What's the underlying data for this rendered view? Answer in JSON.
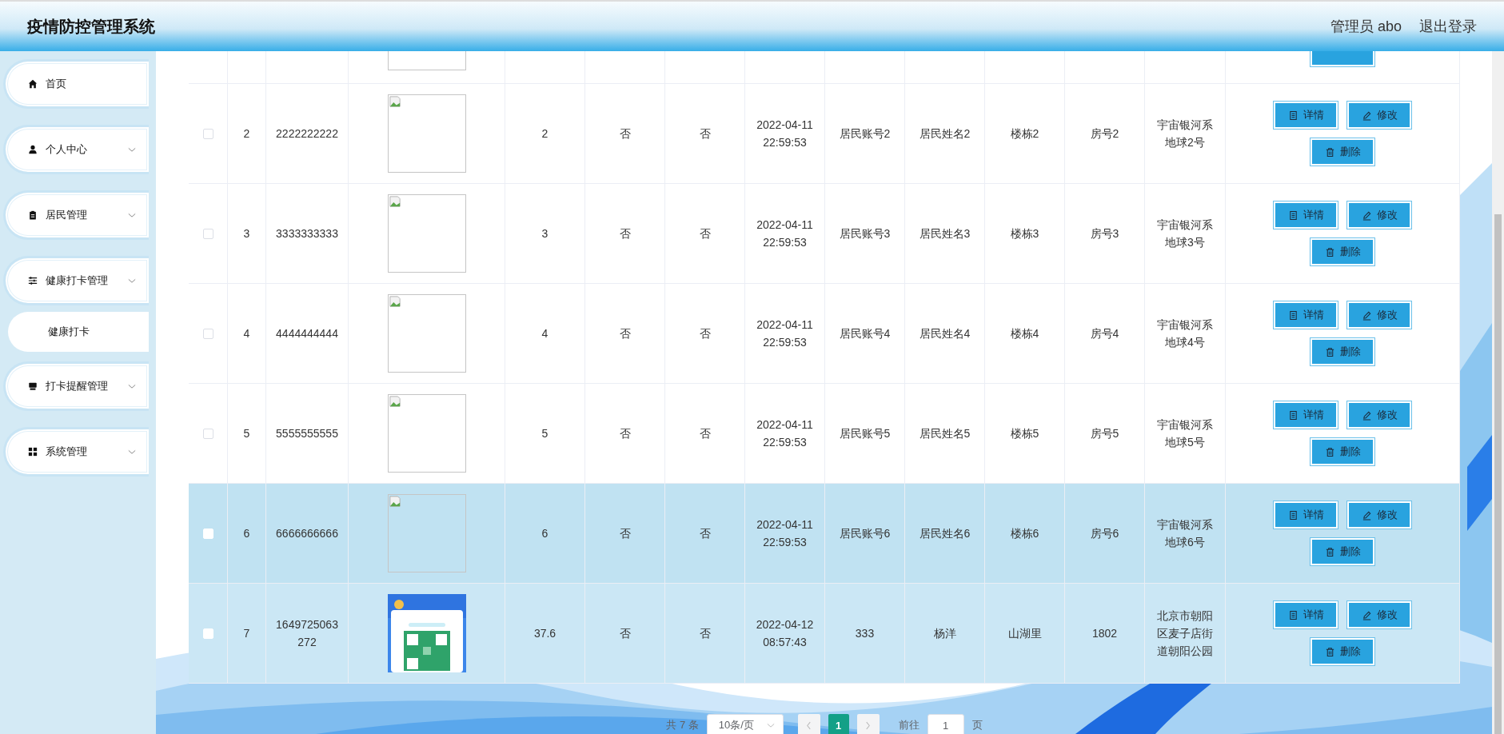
{
  "header": {
    "title": "疫情防控管理系统",
    "user": "管理员 abo",
    "logout": "退出登录"
  },
  "sidebar": {
    "items": [
      {
        "label": "首页",
        "kind": "home",
        "has_arrow": false
      },
      {
        "label": "个人中心",
        "kind": "person",
        "has_arrow": true
      },
      {
        "label": "居民管理",
        "kind": "clipboard",
        "has_arrow": true
      },
      {
        "label": "健康打卡管理",
        "kind": "sliders",
        "has_arrow": true,
        "children": [
          {
            "label": "健康打卡"
          }
        ]
      },
      {
        "label": "打卡提醒管理",
        "kind": "monitor",
        "has_arrow": true
      },
      {
        "label": "系统管理",
        "kind": "grid",
        "has_arrow": true
      }
    ]
  },
  "table": {
    "rows": [
      {
        "kind": "partial",
        "image": {
          "kind": "broken"
        },
        "actions": [
          {
            "kind": "delete"
          }
        ]
      },
      {
        "kind": "full",
        "checked": false,
        "highlighted": false,
        "number": "2",
        "account": "2222222222",
        "image": {
          "kind": "broken"
        },
        "temperature": "2",
        "column_6": "否",
        "column_7": "否",
        "time": "2022-04-11 22:59:53",
        "resident_account": "居民账号2",
        "resident_name": "居民姓名2",
        "building": "楼栋2",
        "room": "房号2",
        "address": "宇宙银河系地球2号",
        "actions": [
          {
            "label": "详情",
            "kind": "detail"
          },
          {
            "label": "修改",
            "kind": "edit"
          },
          {
            "label": "删除",
            "kind": "delete"
          }
        ]
      },
      {
        "kind": "full",
        "checked": false,
        "highlighted": false,
        "number": "3",
        "account": "3333333333",
        "image": {
          "kind": "broken"
        },
        "temperature": "3",
        "column_6": "否",
        "column_7": "否",
        "time": "2022-04-11 22:59:53",
        "resident_account": "居民账号3",
        "resident_name": "居民姓名3",
        "building": "楼栋3",
        "room": "房号3",
        "address": "宇宙银河系地球3号",
        "actions": [
          {
            "label": "详情",
            "kind": "detail"
          },
          {
            "label": "修改",
            "kind": "edit"
          },
          {
            "label": "删除",
            "kind": "delete"
          }
        ]
      },
      {
        "kind": "full",
        "checked": false,
        "highlighted": false,
        "number": "4",
        "account": "4444444444",
        "image": {
          "kind": "broken"
        },
        "temperature": "4",
        "column_6": "否",
        "column_7": "否",
        "time": "2022-04-11 22:59:53",
        "resident_account": "居民账号4",
        "resident_name": "居民姓名4",
        "building": "楼栋4",
        "room": "房号4",
        "address": "宇宙银河系地球4号",
        "actions": [
          {
            "label": "详情",
            "kind": "detail"
          },
          {
            "label": "修改",
            "kind": "edit"
          },
          {
            "label": "删除",
            "kind": "delete"
          }
        ]
      },
      {
        "kind": "full",
        "checked": false,
        "highlighted": false,
        "number": "5",
        "account": "5555555555",
        "image": {
          "kind": "broken"
        },
        "temperature": "5",
        "column_6": "否",
        "column_7": "否",
        "time": "2022-04-11 22:59:53",
        "resident_account": "居民账号5",
        "resident_name": "居民姓名5",
        "building": "楼栋5",
        "room": "房号5",
        "address": "宇宙银河系地球5号",
        "actions": [
          {
            "label": "详情",
            "kind": "detail"
          },
          {
            "label": "修改",
            "kind": "edit"
          },
          {
            "label": "删除",
            "kind": "delete"
          }
        ]
      },
      {
        "kind": "full",
        "checked": false,
        "highlighted": true,
        "number": "6",
        "account": "6666666666",
        "image": {
          "kind": "broken"
        },
        "temperature": "6",
        "column_6": "否",
        "column_7": "否",
        "time": "2022-04-11 22:59:53",
        "resident_account": "居民账号6",
        "resident_name": "居民姓名6",
        "building": "楼栋6",
        "room": "房号6",
        "address": "宇宙银河系地球6号",
        "actions": [
          {
            "label": "详情",
            "kind": "detail"
          },
          {
            "label": "修改",
            "kind": "edit"
          },
          {
            "label": "删除",
            "kind": "delete"
          }
        ]
      },
      {
        "kind": "full",
        "checked": false,
        "highlighted": true,
        "number": "7",
        "account": "1649725063272",
        "temperature": "37.6",
        "column_6": "否",
        "column_7": "否",
        "time": "2022-04-12 08:57:43",
        "resident_account": "333",
        "resident_name": "杨洋",
        "building": "山湖里",
        "room": "1802",
        "address": "北京市朝阳区麦子店街道朝阳公园",
        "actions": [
          {
            "label": "详情",
            "kind": "detail"
          },
          {
            "label": "修改",
            "kind": "edit"
          },
          {
            "label": "删除",
            "kind": "delete"
          }
        ]
      }
    ]
  },
  "pagination": {
    "total": "共 7 条",
    "page_size": "10条/页",
    "pages": [
      {
        "label": "1",
        "selected": true
      }
    ],
    "goto_label": "前往",
    "goto_value": "1",
    "goto_suffix": "页"
  }
}
